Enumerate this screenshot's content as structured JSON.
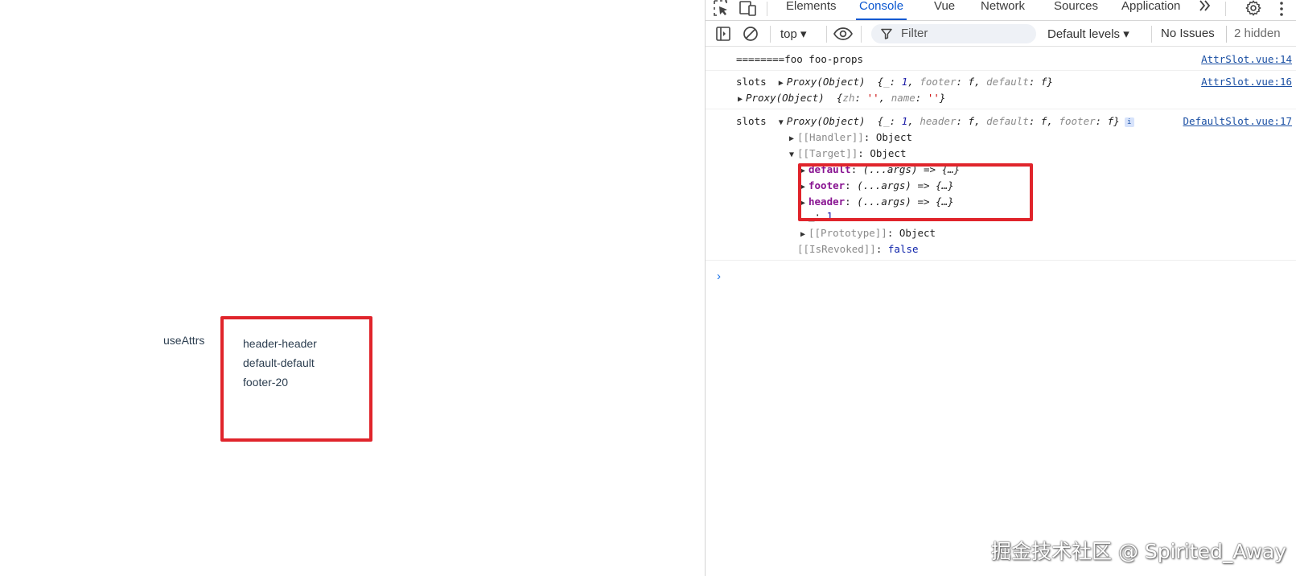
{
  "page": {
    "label": "useAttrs",
    "slot_lines": [
      "header-header",
      "default-default",
      "footer-20"
    ]
  },
  "devtools": {
    "tabs": [
      "Elements",
      "Console",
      "Vue",
      "Network",
      "Sources",
      "Application"
    ],
    "active_tab": "Console",
    "toolbar": {
      "context": "top ▾",
      "filter_placeholder": "Filter",
      "levels": "Default levels ▾",
      "issues": "No Issues",
      "hidden": "2 hidden"
    },
    "console": {
      "line1_text": "========foo foo-props",
      "line1_src": "AttrSlot.vue:14",
      "line2_label": "slots",
      "line2_type": "Proxy(Object)",
      "line2_preview_open": "{",
      "line2_k1": "_",
      "line2_v1": "1",
      "line2_k2": "footer",
      "line2_v2": "f",
      "line2_k3": "default",
      "line2_v3": "f",
      "line2_close": "}",
      "line2_src": "AttrSlot.vue:16",
      "line3_type": "Proxy(Object)",
      "line3_k1": "zh",
      "line3_v1": "''",
      "line3_k2": "name",
      "line3_v2": "''",
      "line4_label": "slots",
      "line4_type": "Proxy(Object)",
      "line4_k1": "_",
      "line4_v1": "1",
      "line4_k2": "header",
      "line4_v2": "f",
      "line4_k3": "default",
      "line4_v3": "f",
      "line4_k4": "footer",
      "line4_v4": "f",
      "line4_src": "DefaultSlot.vue:17",
      "handler_key": "[[Handler]]",
      "handler_val": "Object",
      "target_key": "[[Target]]",
      "target_val": "Object",
      "slot_default_key": "default",
      "slot_footer_key": "footer",
      "slot_header_key": "header",
      "slot_fn": "(...args) => {…}",
      "underscore_key": "_",
      "underscore_val": "1",
      "proto_key": "[[Prototype]]",
      "proto_val": "Object",
      "revoked_key": "[[IsRevoked]]",
      "revoked_val": "false",
      "prompt": "›"
    }
  },
  "watermark": "掘金技术社区 @ Spirited_Away",
  "colors": {
    "highlight_border": "#e0242b",
    "devtools_accent": "#0b57d0",
    "link": "#1a4fa3"
  }
}
